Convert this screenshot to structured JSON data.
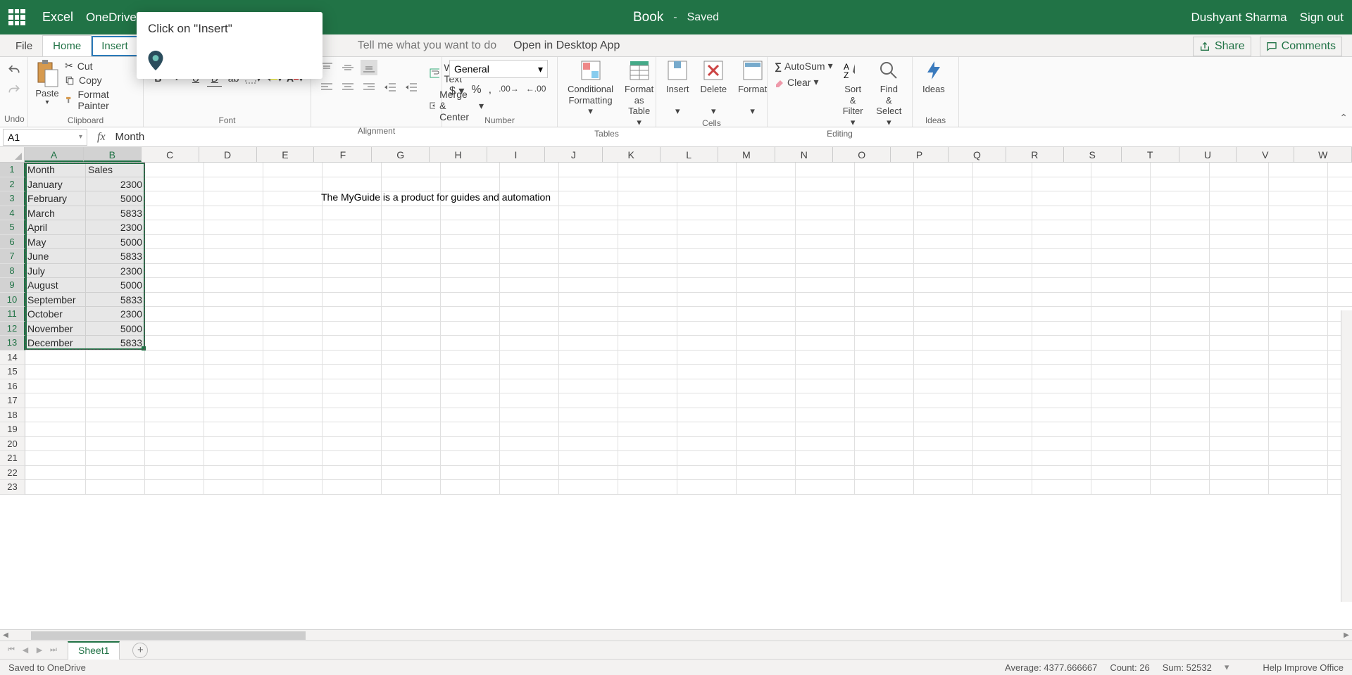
{
  "title": {
    "appName": "Excel",
    "location": "OneDrive",
    "bookName": "Book",
    "savedLabel": "Saved",
    "userName": "Dushyant Sharma",
    "signOut": "Sign out"
  },
  "tabs": {
    "file": "File",
    "home": "Home",
    "insert": "Insert",
    "tellMe": "Tell me what you want to do",
    "openDesktop": "Open in Desktop App",
    "share": "Share",
    "comments": "Comments"
  },
  "tooltip": {
    "text": "Click on \"Insert\""
  },
  "ribbon": {
    "undoLabel": "Undo",
    "pasteLabel": "Paste",
    "cut": "Cut",
    "copy": "Copy",
    "formatPainter": "Format Painter",
    "clipboard": "Clipboard",
    "font": "Font",
    "alignment": "Alignment",
    "wrapText": "Wrap Text",
    "mergeCenter": "Merge & Center",
    "generalFormat": "General",
    "number": "Number",
    "condFormat": "Conditional Formatting",
    "formatTable": "Format as Table",
    "tables": "Tables",
    "insert": "Insert",
    "delete": "Delete",
    "format": "Format",
    "cells": "Cells",
    "autosum": "AutoSum",
    "clear": "Clear",
    "sortFilter": "Sort & Filter",
    "findSelect": "Find & Select",
    "editing": "Editing",
    "ideas": "Ideas"
  },
  "formulaBar": {
    "nameBox": "A1",
    "value": "Month"
  },
  "columns": [
    "A",
    "B",
    "C",
    "D",
    "E",
    "F",
    "G",
    "H",
    "I",
    "J",
    "K",
    "L",
    "M",
    "N",
    "O",
    "P",
    "Q",
    "R",
    "S",
    "T",
    "U",
    "V",
    "W"
  ],
  "rows": [
    1,
    2,
    3,
    4,
    5,
    6,
    7,
    8,
    9,
    10,
    11,
    12,
    13,
    14,
    15,
    16,
    17,
    18,
    19,
    20,
    21,
    22,
    23
  ],
  "data": {
    "A1": "Month",
    "B1": "Sales",
    "A2": "January",
    "B2": "2300",
    "A3": "February",
    "B3": "5000",
    "A4": "March",
    "B4": "5833",
    "A5": "April",
    "B5": "2300",
    "A6": "May",
    "B6": "5000",
    "A7": "June",
    "B7": "5833",
    "A8": "July",
    "B8": "2300",
    "A9": "August",
    "B9": "5000",
    "A10": "September",
    "B10": "5833",
    "A11": "October",
    "B11": "2300",
    "A12": "November",
    "B12": "5000",
    "A13": "December",
    "B13": "5833"
  },
  "overflow": {
    "F3": "The MyGuide is a product for guides and automation"
  },
  "sheet": {
    "name": "Sheet1"
  },
  "status": {
    "saved": "Saved to OneDrive",
    "average": "Average: 4377.666667",
    "count": "Count: 26",
    "sum": "Sum: 52532",
    "help": "Help Improve Office"
  }
}
